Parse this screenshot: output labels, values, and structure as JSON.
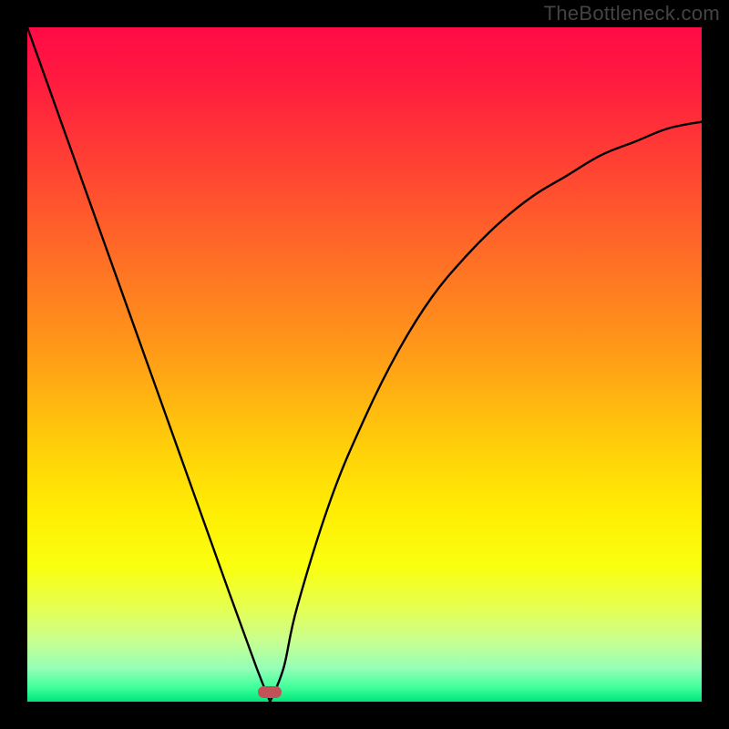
{
  "attribution": "TheBottleneck.com",
  "chart_data": {
    "type": "line",
    "title": "",
    "xlabel": "",
    "ylabel": "",
    "xlim": [
      0,
      100
    ],
    "ylim": [
      0,
      100
    ],
    "legend": false,
    "grid": false,
    "background_gradient": {
      "orientation": "vertical",
      "stops": [
        {
          "pos": 0.0,
          "color": "#ff0b46"
        },
        {
          "pos": 0.5,
          "color": "#ffb400"
        },
        {
          "pos": 0.8,
          "color": "#ffff20"
        },
        {
          "pos": 1.0,
          "color": "#00e57a"
        }
      ]
    },
    "series": [
      {
        "name": "bottleneck-curve",
        "color": "#000000",
        "x": [
          0,
          5,
          10,
          15,
          20,
          25,
          30,
          34,
          36,
          38,
          40,
          45,
          50,
          55,
          60,
          65,
          70,
          75,
          80,
          85,
          90,
          95,
          100
        ],
        "values": [
          100,
          86,
          72,
          58,
          44,
          30,
          16,
          5,
          0,
          5,
          14,
          30,
          42,
          52,
          60,
          66,
          71,
          75,
          78,
          81,
          83,
          85,
          86
        ]
      }
    ],
    "annotations": [
      {
        "name": "optimal-marker",
        "shape": "pill",
        "x": 36,
        "y": 1,
        "color": "#c05258"
      }
    ]
  }
}
